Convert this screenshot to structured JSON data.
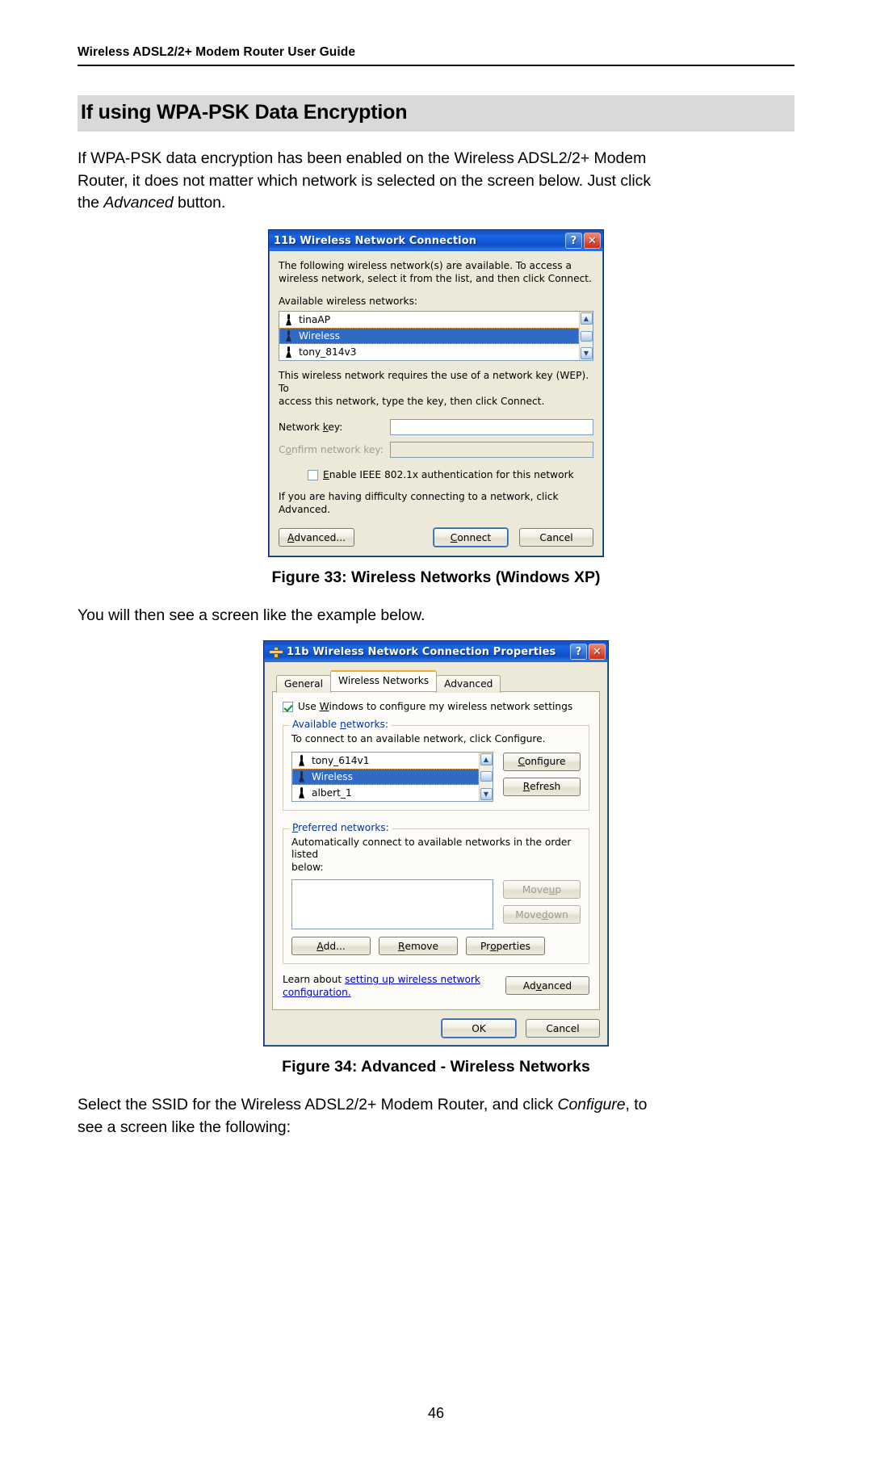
{
  "header": {
    "running_head": "Wireless ADSL2/2+ Modem Router User Guide"
  },
  "section": {
    "heading": "If using WPA-PSK Data Encryption"
  },
  "paragraphs": {
    "intro_1": "If WPA-PSK data encryption has been enabled on the Wireless ADSL2/2+ Modem",
    "intro_2": "Router, it does not matter which network is selected on the screen below. Just click",
    "intro_3_pre": "the ",
    "intro_3_em": "Advanced",
    "intro_3_post": " button.",
    "after_fig33": "You will then see a screen like the example below.",
    "after_fig34_1_pre": "Select the SSID for the Wireless ADSL2/2+ Modem Router, and click ",
    "after_fig34_1_em": "Configure",
    "after_fig34_1_post": ", to",
    "after_fig34_2": "see a screen like the following:"
  },
  "figure33": {
    "caption": "Figure 33: Wireless Networks (Windows XP)",
    "title": "11b Wireless Network Connection",
    "help_button": "?",
    "close_button": "✕",
    "intro_line1": "The following wireless network(s) are available. To access a",
    "intro_line2": "wireless network, select it from the list, and then click Connect.",
    "available_label": "Available wireless networks:",
    "networks": [
      {
        "name": "tinaAP",
        "selected": false
      },
      {
        "name": "Wireless",
        "selected": true
      },
      {
        "name": "tony_814v3",
        "selected": false
      }
    ],
    "notice_line1": "This wireless network requires the use of a network key (WEP). To",
    "notice_line2": "access this network, type the key, then click Connect.",
    "network_key_label_pre": "Network ",
    "network_key_label_u": "k",
    "network_key_label_post": "ey:",
    "network_key_value": "",
    "confirm_key_label_pre": "C",
    "confirm_key_label_u": "o",
    "confirm_key_label_post": "nfirm network key:",
    "confirm_key_value": "",
    "enable_8021x_pre": "",
    "enable_8021x_u": "E",
    "enable_8021x_post": "nable IEEE 802.1x authentication for this network",
    "enable_8021x_checked": false,
    "difficulty_text": "If you are having difficulty connecting to a network, click Advanced.",
    "btn_advanced_u": "A",
    "btn_advanced_post": "dvanced...",
    "btn_connect_pre": "",
    "btn_connect_u": "C",
    "btn_connect_post": "onnect",
    "btn_cancel": "Cancel",
    "scroll_up": "▲",
    "scroll_down": "▼"
  },
  "figure34": {
    "caption": "Figure 34: Advanced - Wireless Networks",
    "title": "11b Wireless Network Connection Properties",
    "help_button": "?",
    "close_button": "✕",
    "tabs": [
      {
        "label": "General",
        "active": false
      },
      {
        "label": "Wireless Networks",
        "active": true
      },
      {
        "label": "Advanced",
        "active": false
      }
    ],
    "use_windows_pre": "Use ",
    "use_windows_u": "W",
    "use_windows_post": "indows to configure my wireless network settings",
    "use_windows_checked": true,
    "available_legend_pre": "Available ",
    "available_legend_u": "n",
    "available_legend_post": "etworks:",
    "available_desc": "To connect to an available network, click Configure.",
    "available_networks": [
      {
        "name": "tony_614v1",
        "selected": false
      },
      {
        "name": "Wireless",
        "selected": true
      },
      {
        "name": "albert_1",
        "selected": false
      }
    ],
    "btn_configure_pre": "",
    "btn_configure_u": "C",
    "btn_configure_post": "onfigure",
    "btn_refresh_pre": "",
    "btn_refresh_u": "R",
    "btn_refresh_post": "efresh",
    "preferred_legend_pre": "",
    "preferred_legend_u": "P",
    "preferred_legend_post": "referred networks:",
    "preferred_desc_line1": "Automatically connect to available networks in the order listed",
    "preferred_desc_line2": "below:",
    "preferred_networks": [],
    "btn_moveup_pre": "Move ",
    "btn_moveup_u": "u",
    "btn_moveup_post": "p",
    "btn_movedown_pre": "Move ",
    "btn_movedown_u": "d",
    "btn_movedown_post": "own",
    "btn_add_u": "A",
    "btn_add_post": "dd...",
    "btn_remove_pre": "",
    "btn_remove_u": "R",
    "btn_remove_post": "emove",
    "btn_properties_pre": "Pr",
    "btn_properties_u": "o",
    "btn_properties_post": "perties",
    "learn_text": "Learn about ",
    "learn_link_line1": "setting up wireless network",
    "learn_link_line2": "configuration.",
    "btn_advanced_pre": "Ad",
    "btn_advanced_u": "v",
    "btn_advanced_post": "anced",
    "btn_ok": "OK",
    "btn_cancel": "Cancel",
    "scroll_up": "▲",
    "scroll_down": "▼"
  },
  "footer": {
    "page_number": "46"
  }
}
